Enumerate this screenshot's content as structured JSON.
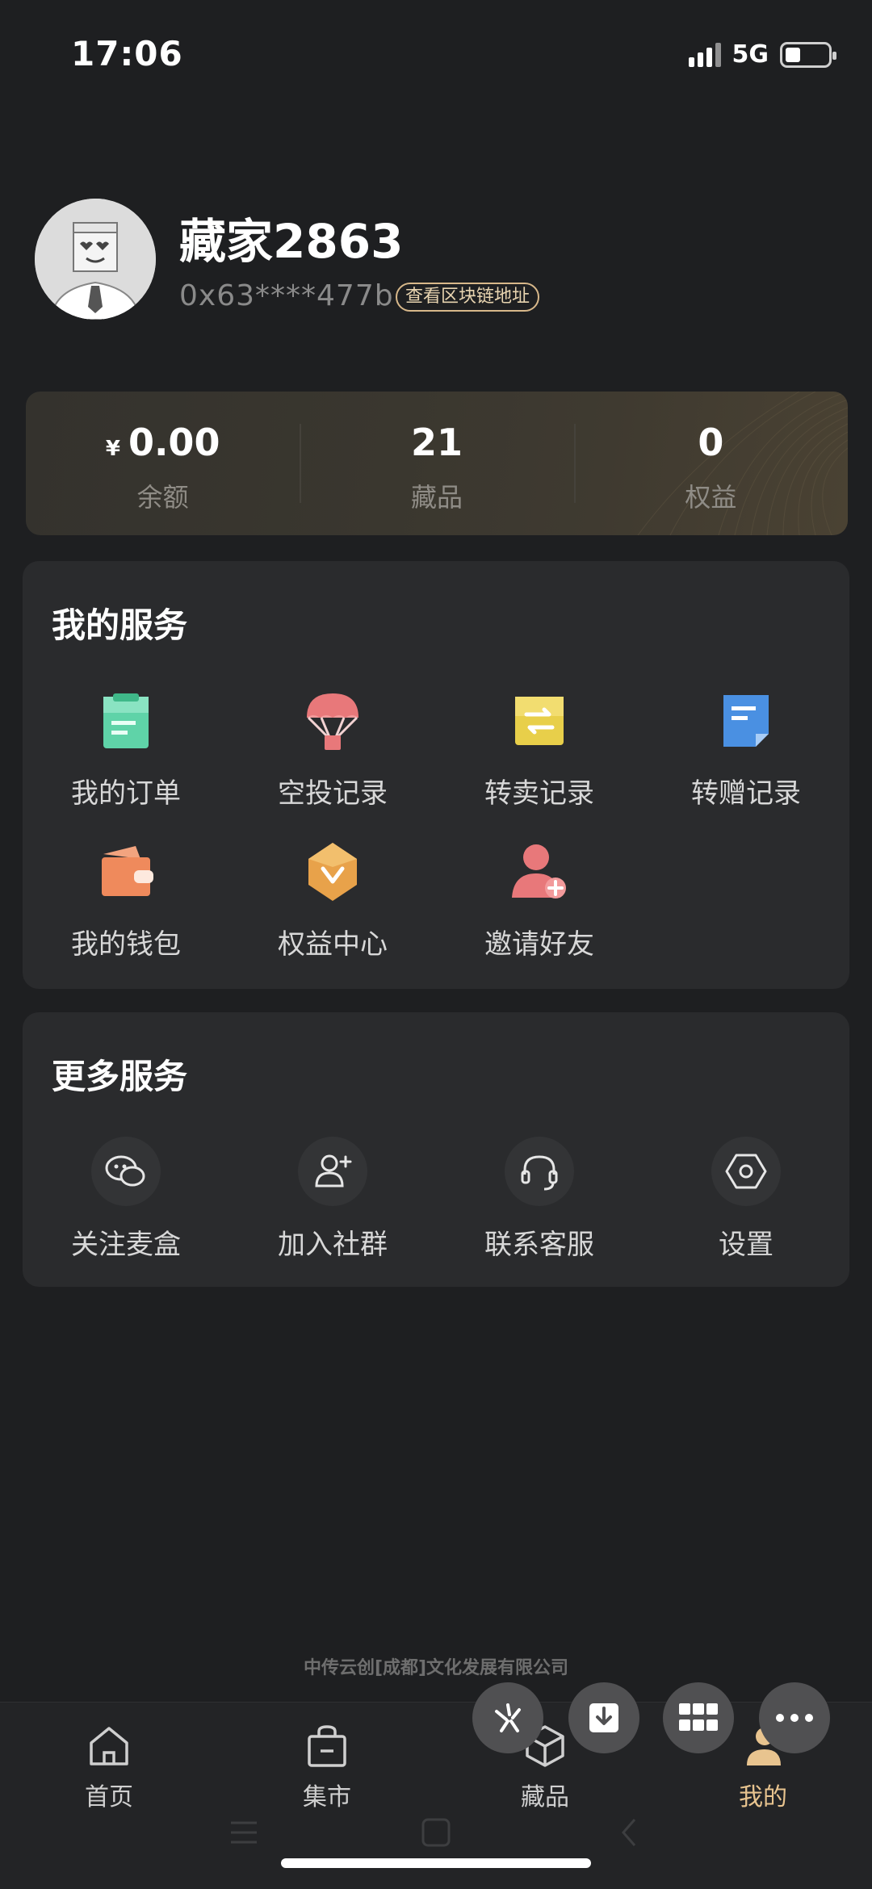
{
  "status": {
    "time": "17:06",
    "network": "5G"
  },
  "profile": {
    "username": "藏家2863",
    "address": "0x63****477b",
    "chain_button": "查看区块链地址"
  },
  "stats": [
    {
      "currency": "¥",
      "value": "0.00",
      "label": "余额"
    },
    {
      "value": "21",
      "label": "藏品"
    },
    {
      "value": "0",
      "label": "权益"
    }
  ],
  "my_services": {
    "title": "我的服务",
    "items": [
      {
        "label": "我的订单",
        "icon": "order-icon",
        "color": "#5fd3a8"
      },
      {
        "label": "空投记录",
        "icon": "parachute-icon",
        "color": "#e8787a"
      },
      {
        "label": "转卖记录",
        "icon": "exchange-icon",
        "color": "#e8cf4a"
      },
      {
        "label": "转赠记录",
        "icon": "document-icon",
        "color": "#4a90e2"
      },
      {
        "label": "我的钱包",
        "icon": "wallet-icon",
        "color": "#ef8a5c"
      },
      {
        "label": "权益中心",
        "icon": "badge-icon",
        "color": "#e8a24a"
      },
      {
        "label": "邀请好友",
        "icon": "add-friend-icon",
        "color": "#e8787a"
      }
    ]
  },
  "more_services": {
    "title": "更多服务",
    "items": [
      {
        "label": "关注麦盒",
        "icon": "wechat-icon"
      },
      {
        "label": "加入社群",
        "icon": "add-user-icon"
      },
      {
        "label": "联系客服",
        "icon": "headset-icon"
      },
      {
        "label": "设置",
        "icon": "settings-icon"
      }
    ]
  },
  "footer": {
    "company": "中传云创[成都]文化发展有限公司"
  },
  "tabbar": [
    {
      "label": "首页",
      "icon": "home-icon"
    },
    {
      "label": "集市",
      "icon": "bag-icon"
    },
    {
      "label": "藏品",
      "icon": "cube-icon"
    },
    {
      "label": "我的",
      "icon": "profile-icon",
      "active": true
    }
  ],
  "accent_color": "#e8c48f"
}
